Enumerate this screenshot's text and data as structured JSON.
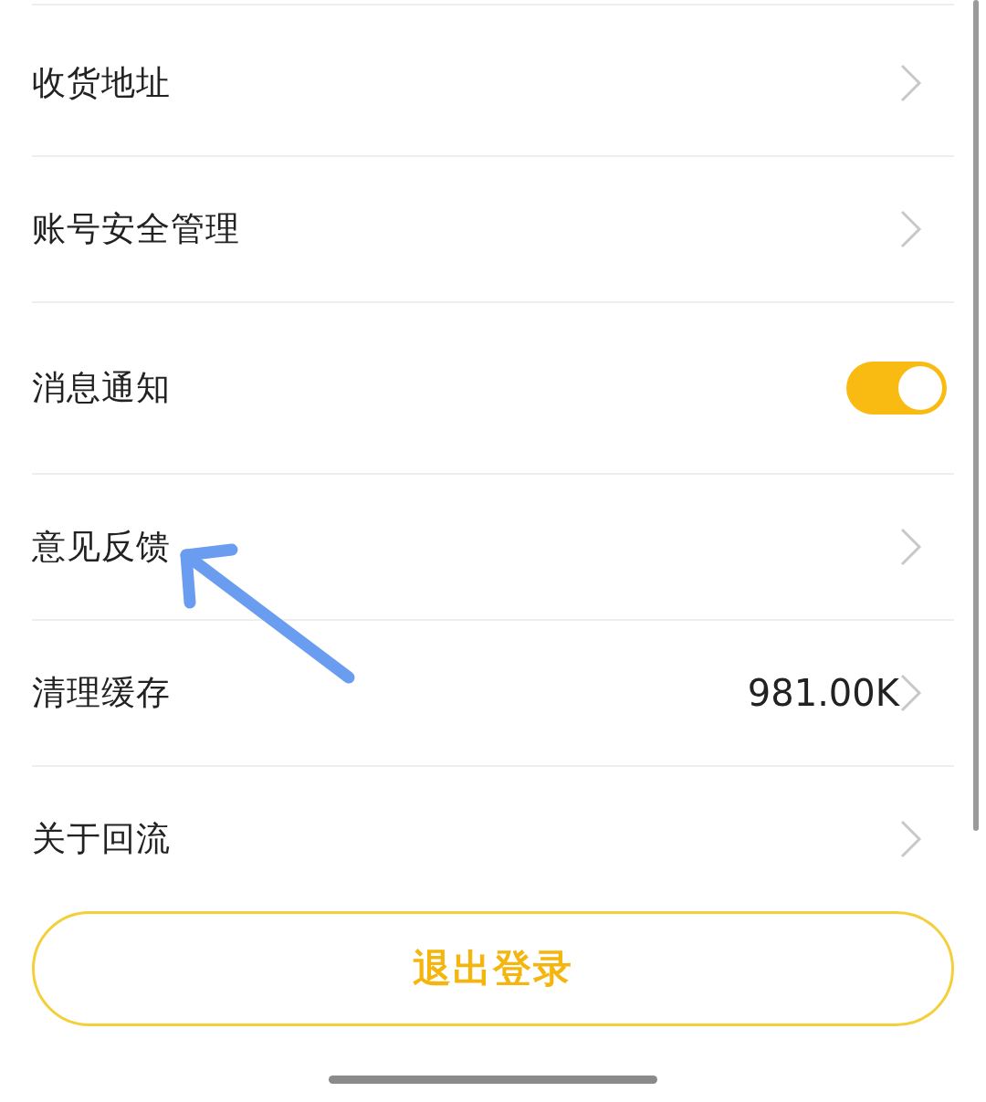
{
  "settings": [
    {
      "kind": "link",
      "label": "收货地址"
    },
    {
      "kind": "link",
      "label": "账号安全管理"
    },
    {
      "kind": "toggle",
      "label": "消息通知",
      "on": true
    },
    {
      "kind": "link",
      "label": "意见反馈"
    },
    {
      "kind": "value",
      "label": "清理缓存",
      "value": "981.00K"
    },
    {
      "kind": "link",
      "label": "关于回流"
    }
  ],
  "logout_button": {
    "label": "退出登录"
  }
}
